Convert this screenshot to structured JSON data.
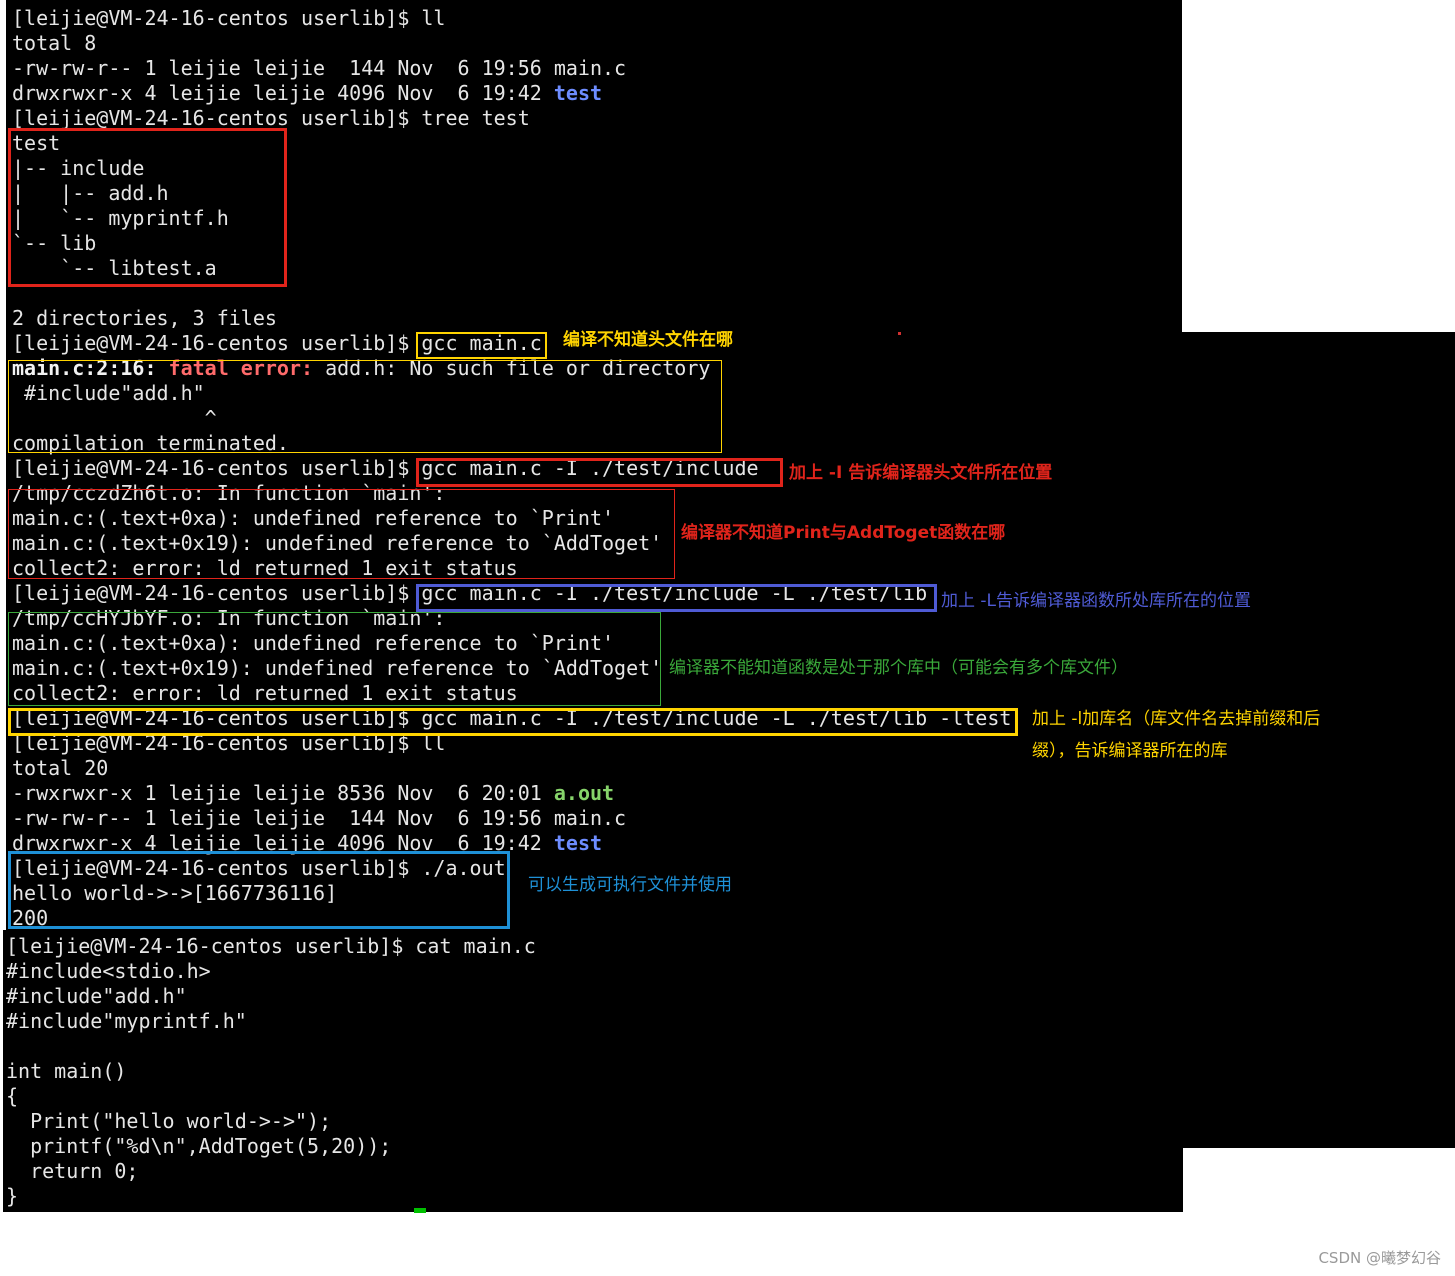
{
  "terminal": {
    "lines": [
      "[leijie@VM-24-16-centos userlib]$ ll",
      "total 8",
      "-rw-rw-r-- 1 leijie leijie  144 Nov  6 19:56 main.c",
      {
        "pre": "drwxrwxr-x 4 leijie leijie 4096 Nov  6 19:42 ",
        "hl": "test",
        "hl_color": "blue"
      },
      "[leijie@VM-24-16-centos userlib]$ tree test",
      "test",
      "|-- include",
      "|   |-- add.h",
      "|   `-- myprintf.h",
      "`-- lib",
      "    `-- libtest.a",
      "",
      "2 directories, 3 files",
      "[leijie@VM-24-16-centos userlib]$ gcc main.c",
      {
        "pre": "",
        "hl": "main.c:2:16: ",
        "hl_color": "white",
        "hl2": "fatal error: ",
        "hl2_color": "red",
        "post": "add.h: No such file or directory"
      },
      " #include\"add.h\"",
      "                ^",
      "compilation terminated.",
      "[leijie@VM-24-16-centos userlib]$ gcc main.c -I ./test/include",
      "/tmp/cczdZh6t.o: In function `main':",
      "main.c:(.text+0xa): undefined reference to `Print'",
      "main.c:(.text+0x19): undefined reference to `AddToget'",
      "collect2: error: ld returned 1 exit status",
      "[leijie@VM-24-16-centos userlib]$ gcc main.c -I ./test/include -L ./test/lib",
      "/tmp/ccHYJbYF.o: In function `main':",
      "main.c:(.text+0xa): undefined reference to `Print'",
      "main.c:(.text+0x19): undefined reference to `AddToget'",
      "collect2: error: ld returned 1 exit status",
      "[leijie@VM-24-16-centos userlib]$ gcc main.c -I ./test/include -L ./test/lib -ltest",
      "[leijie@VM-24-16-centos userlib]$ ll",
      "total 20",
      {
        "pre": "-rwxrwxr-x 1 leijie leijie 8536 Nov  6 20:01 ",
        "hl": "a.out",
        "hl_color": "green"
      },
      "-rw-rw-r-- 1 leijie leijie  144 Nov  6 19:56 main.c",
      {
        "pre": "drwxrwxr-x 4 leijie leijie 4096 Nov  6 19:42 ",
        "hl": "test",
        "hl_color": "blue"
      },
      "[leijie@VM-24-16-centos userlib]$ ./a.out",
      "hello world->->[1667736116]",
      "200"
    ],
    "lines_bottom": [
      "[leijie@VM-24-16-centos userlib]$ cat main.c",
      "#include<stdio.h>",
      "#include\"add.h\"",
      "#include\"myprintf.h\"",
      "",
      "int main()",
      "{",
      "  Print(\"hello world->->\");",
      "  printf(\"%d\\n\",AddToget(5,20));",
      "  return 0;",
      "}"
    ]
  },
  "annotations": [
    {
      "text": "编译不知道头文件在哪",
      "color": "#ffd400"
    },
    {
      "text": "加上 -I 告诉编译器头文件所在位置",
      "color": "#e0241b"
    },
    {
      "text": "编译器不知道Print与AddToget函数在哪",
      "color": "#e0241b"
    },
    {
      "text": "加上 -L告诉编译器函数所处库所在的位置",
      "color": "#4f5bd5"
    },
    {
      "text": "编译器不能知道函数是处于那个库中（可能会有多个库文件）",
      "color": "#3aa83a"
    },
    {
      "text": "加上 -l加库名（库文件名去掉前缀和后",
      "color": "#ffd400"
    },
    {
      "text": "缀），告诉编译器所在的库",
      "color": "#ffd400"
    },
    {
      "text": "可以生成可执行文件并使用",
      "color": "#1e90d6"
    }
  ],
  "colors": {
    "term_bg": "#000000",
    "term_fg": "#e6e6e6",
    "dir_blue": "#6d8cff",
    "exec_green": "#86d36a",
    "error_red": "#ff6b6b",
    "box_red": "#e0241b",
    "box_yellow": "#ffd400",
    "box_blue": "#4f5bd5",
    "box_green": "#3aa83a",
    "box_cyan": "#1e90d6"
  },
  "watermark": "CSDN @曦梦幻谷"
}
